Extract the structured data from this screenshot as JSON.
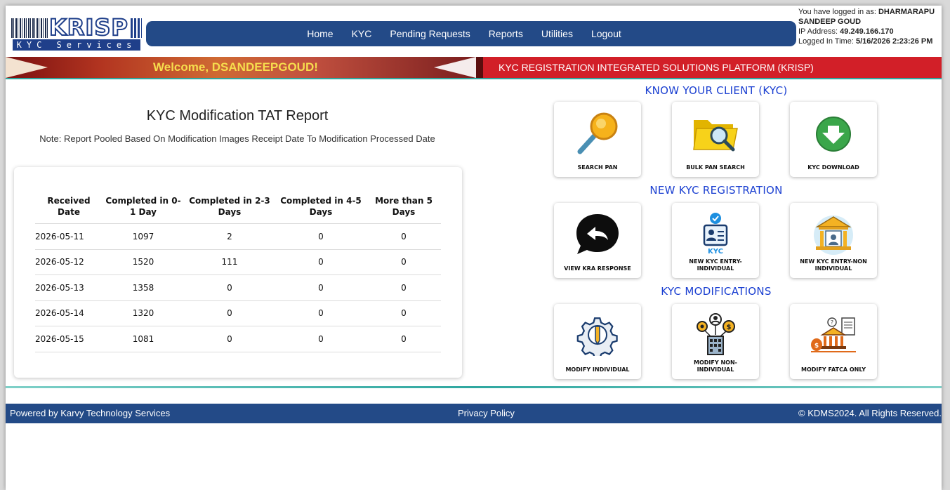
{
  "logo": {
    "brand": "KRISP",
    "sub": "KYC Services"
  },
  "nav": {
    "items": [
      "Home",
      "KYC",
      "Pending Requests",
      "Reports",
      "Utilities",
      "Logout"
    ]
  },
  "login": {
    "prefix": "You have logged in as:",
    "user": "DHARMARAPU SANDEEP GOUD",
    "ip_label": "IP Address:",
    "ip": "49.249.166.170",
    "time_label": "Logged In Time:",
    "time": "5/16/2026 2:23:26 PM"
  },
  "banner": {
    "welcome": "Welcome, DSANDEEPGOUD!",
    "platform": "KYC REGISTRATION INTEGRATED SOLUTIONS PLATFORM (KRISP)"
  },
  "report": {
    "title": "KYC Modification TAT Report",
    "note": "Note: Report Pooled Based On Modification Images Receipt Date To Modification Processed Date",
    "headers": [
      "Received Date",
      "Completed in 0-1 Day",
      "Completed in 2-3 Days",
      "Completed in 4-5 Days",
      "More than 5 Days"
    ],
    "rows": [
      [
        "2026-05-11",
        "1097",
        "2",
        "0",
        "0"
      ],
      [
        "2026-05-12",
        "1520",
        "111",
        "0",
        "0"
      ],
      [
        "2026-05-13",
        "1358",
        "0",
        "0",
        "0"
      ],
      [
        "2026-05-14",
        "1320",
        "0",
        "0",
        "0"
      ],
      [
        "2026-05-15",
        "1081",
        "0",
        "0",
        "0"
      ]
    ]
  },
  "sections": {
    "kyc": "KNOW YOUR CLIENT (KYC)",
    "new_reg": "NEW KYC REGISTRATION",
    "mods": "KYC MODIFICATIONS"
  },
  "tiles": {
    "search_pan": "SEARCH PAN",
    "bulk_pan": "BULK PAN SEARCH",
    "kyc_download": "KYC DOWNLOAD",
    "view_kra": "VIEW KRA RESPONSE",
    "new_individual": "NEW KYC ENTRY-INDIVIDUAL",
    "new_non_individual": "NEW KYC ENTRY-NON INDIVIDUAL",
    "modify_individual": "MODIFY INDIVIDUAL",
    "modify_non_individual": "MODIFY NON-INDIVIDUAL",
    "modify_fatca": "MODIFY FATCA ONLY",
    "kyc_badge": "KYC"
  },
  "footer": {
    "powered": "Powered by Karvy Technology Services",
    "privacy": "Privacy Policy",
    "copyright": "© KDMS2024. All Rights Reserved."
  },
  "colors": {
    "nav": "#234a87",
    "banner_red": "#d21f28",
    "heading_blue": "#1a3fd1",
    "accent_teal": "#2fa7a0",
    "welcome_yellow": "#f6dd4d"
  }
}
